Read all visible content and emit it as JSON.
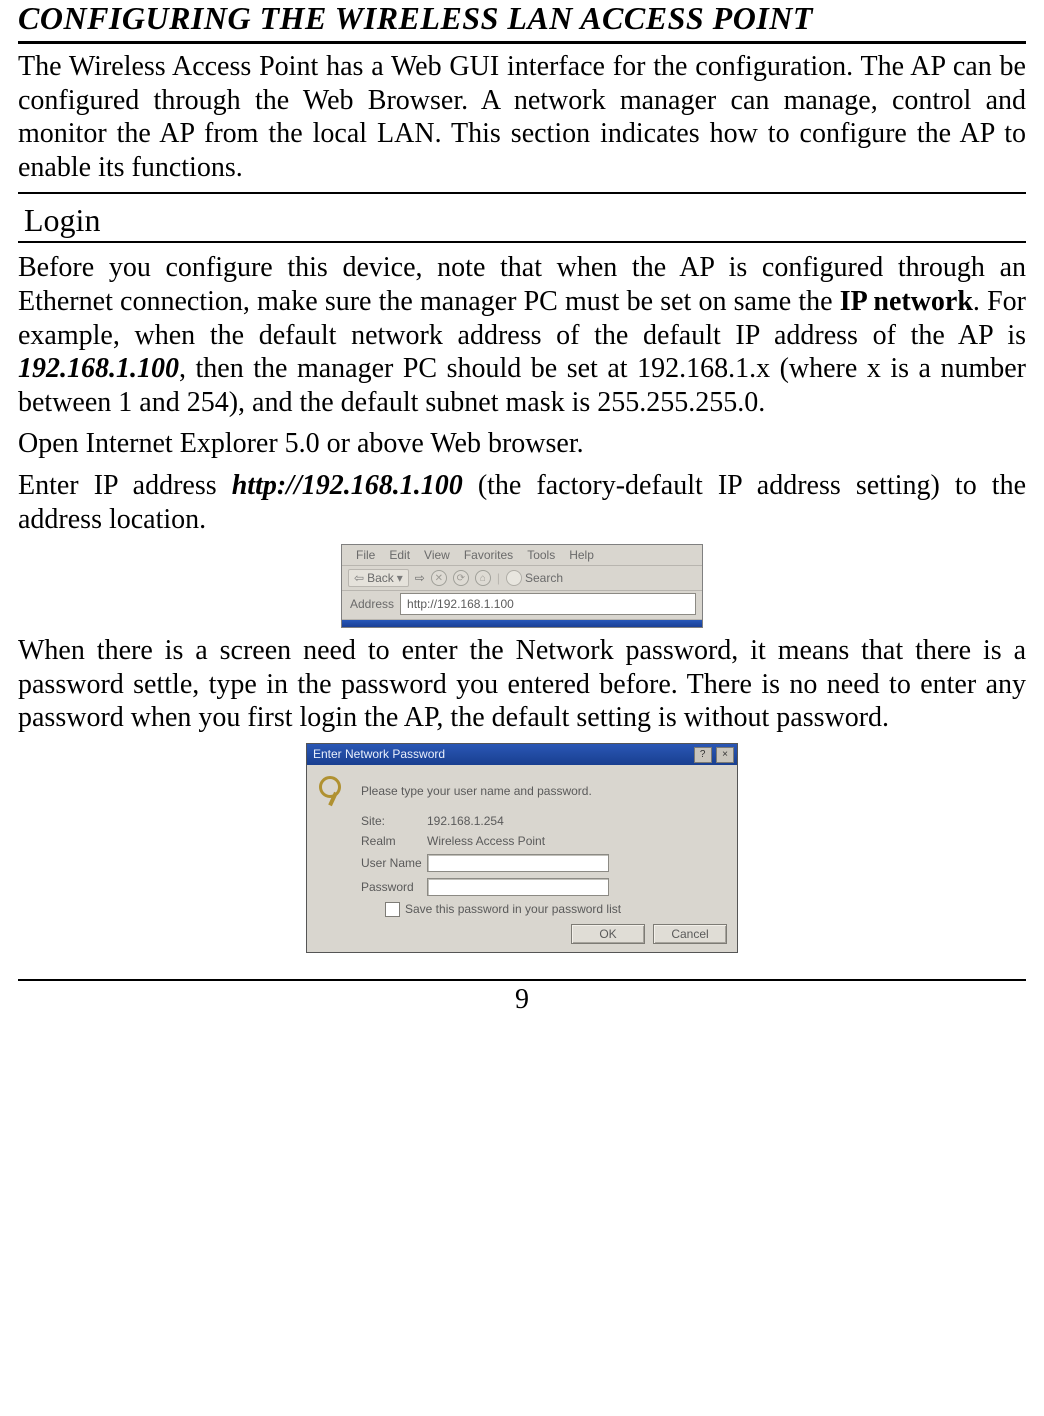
{
  "title": "CONFIGURING THE WIRELESS LAN ACCESS POINT",
  "intro": "The Wireless Access Point has a Web GUI interface for the configuration. The AP can be configured through the Web Browser. A network manager can manage, control and monitor the AP from the local LAN. This section indicates how to configure the AP to enable its functions.",
  "section_login_title": "Login",
  "para1_a": "Before you configure this device, note that when the AP is configured through an Ethernet connection, make sure the manager PC must be set on same the ",
  "para1_bold": "IP network",
  "para1_b": ". For example, when the default network address of the default IP address of the AP is ",
  "para1_bi": "192.168.1.100",
  "para1_c": ", then the manager PC should be set at 192.168.1.x (where x is a number between 1 and 254), and the default subnet mask is 255.255.255.0.",
  "para2": "Open Internet Explorer 5.0 or above Web browser.",
  "para3_a": "Enter IP address ",
  "para3_bi": "http://192.168.1.100",
  "para3_b": " (the factory-default IP address setting) to the address location.",
  "ie": {
    "menu": {
      "file": "File",
      "edit": "Edit",
      "view": "View",
      "favorites": "Favorites",
      "tools": "Tools",
      "help": "Help"
    },
    "back_label": "Back",
    "search_label": "Search",
    "address_label": "Address",
    "address_value": "http://192.168.1.100"
  },
  "para4": "When there is a screen need to enter the Network password, it means that there is a password settle, type in the password you entered before. There is no need to enter any password when you first login the AP, the default setting is without password.",
  "np": {
    "title": "Enter Network Password",
    "instr": "Please type your user name and password.",
    "site_lbl": "Site:",
    "site_val": "192.168.1.254",
    "realm_lbl": "Realm",
    "realm_val": "Wireless Access Point",
    "user_lbl": "User Name",
    "pass_lbl": "Password",
    "save_lbl": "Save this password in your password list",
    "ok": "OK",
    "cancel": "Cancel"
  },
  "page_number": "9"
}
